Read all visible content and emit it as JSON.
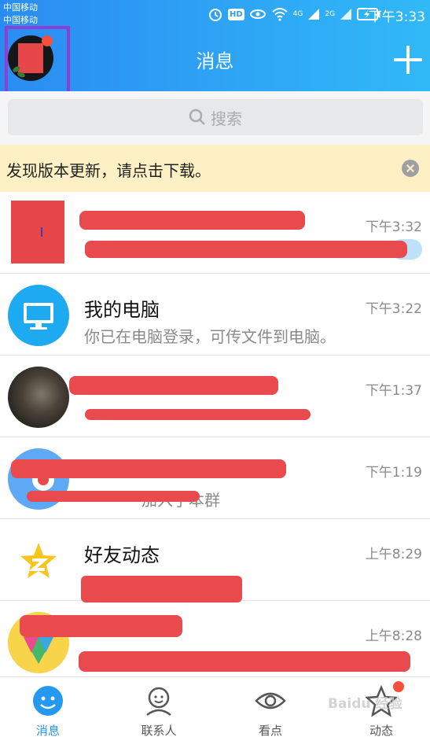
{
  "status_bar": {
    "carrier_1": "中国移动",
    "carrier_2": "中国移动",
    "signal_1_label": "4G",
    "signal_2_label": "2G",
    "hd_badge": "HD",
    "time": "下午3:33"
  },
  "header": {
    "title": "消息",
    "add_icon": "plus-icon",
    "background_from": "#2a8cf2",
    "background_to": "#31b9f7"
  },
  "search": {
    "placeholder": "搜索",
    "icon": "search-icon"
  },
  "notice": {
    "text": "发现版本更新，请点击下载。",
    "close_icon": "close-circle-icon",
    "background": "#fdf0c4"
  },
  "conversations": [
    {
      "name": "",
      "preview": "",
      "time": "下午3:32",
      "avatar": "red-square-avatar",
      "redacted": true
    },
    {
      "name": "我的电脑",
      "preview": "你已在电脑登录，可传文件到电脑。",
      "time": "下午3:22",
      "avatar": "monitor-icon",
      "redacted": false
    },
    {
      "name": "",
      "preview": "",
      "time": "下午1:37",
      "avatar": "photo-avatar",
      "redacted": true
    },
    {
      "name": "",
      "preview": "加入了本群",
      "time": "下午1:19",
      "avatar": "group-avatar",
      "redacted": true
    },
    {
      "name": "好友动态",
      "preview": "",
      "time": "上午8:29",
      "avatar": "qzone-star-icon",
      "redacted": true
    },
    {
      "name": "",
      "preview": "",
      "time": "上午8:28",
      "avatar": "gem-avatar",
      "redacted": true
    }
  ],
  "tabbar": {
    "items": [
      {
        "label": "消息",
        "icon": "message-icon",
        "active": true
      },
      {
        "label": "联系人",
        "icon": "contacts-icon",
        "active": false
      },
      {
        "label": "看点",
        "icon": "eye-icon",
        "active": false
      },
      {
        "label": "动态",
        "icon": "star-icon",
        "active": false
      }
    ],
    "active_color": "#2598f0"
  },
  "watermark": "Baidu 经验",
  "redaction_color": "#e84a4e",
  "highlight_color": "#8b3fd3"
}
